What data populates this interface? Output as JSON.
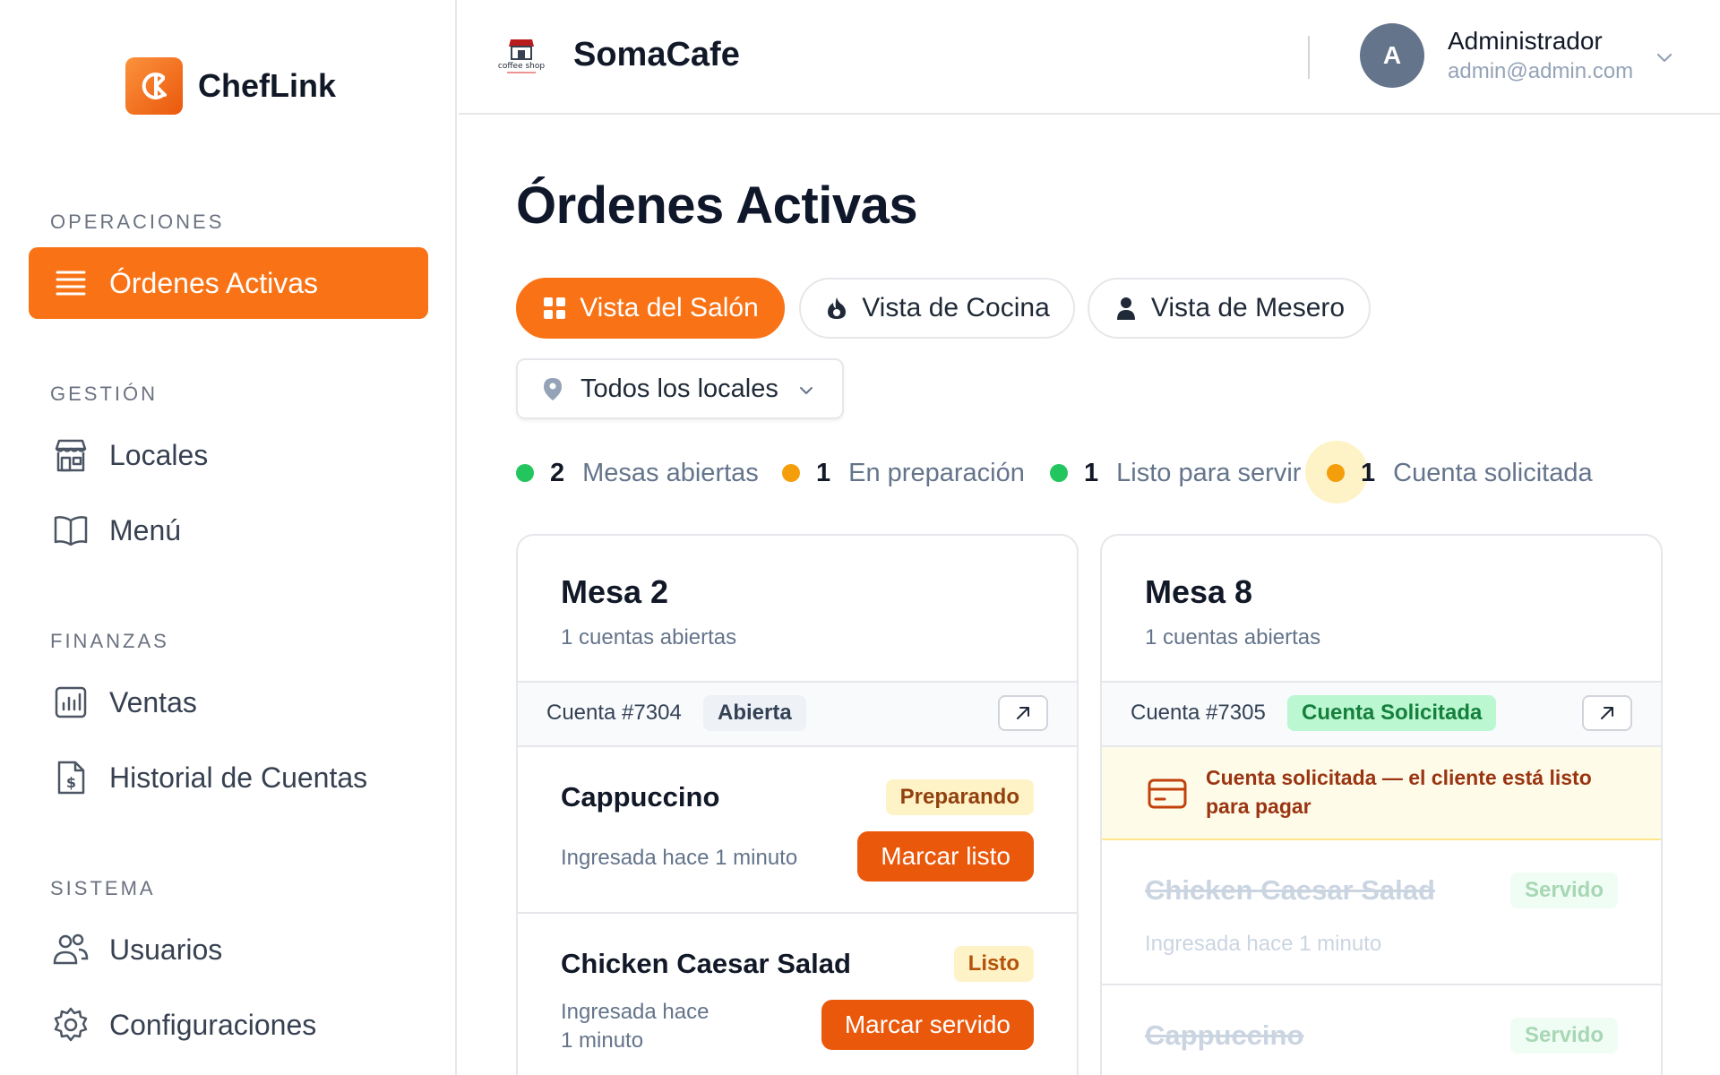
{
  "sidebar": {
    "brand": "ChefLink",
    "sections": {
      "operaciones": "OPERACIONES",
      "gestion": "GESTIÓN",
      "finanzas": "FINANZAS",
      "sistema": "SISTEMA"
    },
    "items": {
      "ordenes": "Órdenes Activas",
      "locales": "Locales",
      "menu": "Menú",
      "ventas": "Ventas",
      "historial": "Historial de Cuentas",
      "usuarios": "Usuarios",
      "configuraciones": "Configuraciones"
    },
    "active_item": "ordenes"
  },
  "header": {
    "shop_name": "SomaCafe",
    "logo_text": "coffee shop",
    "user": {
      "initial": "A",
      "name": "Administrador",
      "email": "admin@admin.com"
    }
  },
  "main": {
    "title": "Órdenes Activas",
    "tabs": {
      "salon": "Vista del Salón",
      "cocina": "Vista de Cocina",
      "mesero": "Vista de Mesero"
    },
    "active_tab": "salon",
    "locale_filter": "Todos los locales",
    "stats": [
      {
        "count": "2",
        "label": "Mesas abiertas",
        "color": "#22c55e"
      },
      {
        "count": "1",
        "label": "En preparación",
        "color": "#f59e0b"
      },
      {
        "count": "1",
        "label": "Listo para servir",
        "color": "#22c55e"
      },
      {
        "count": "1",
        "label": "Cuenta solicitada",
        "color": "#f59e0b"
      }
    ]
  },
  "cards": [
    {
      "title": "Mesa 2",
      "subtitle": "1 cuentas abiertas",
      "account": "Cuenta #7304",
      "account_status": "Abierta",
      "items": [
        {
          "name": "Cappuccino",
          "time": "Ingresada hace 1 minuto",
          "status": "Preparando",
          "action": "Marcar listo"
        },
        {
          "name": "Chicken Caesar Salad",
          "time_line1": "Ingresada hace",
          "time_line2": "1 minuto",
          "status": "Listo",
          "action": "Marcar servido"
        }
      ]
    },
    {
      "title": "Mesa 8",
      "subtitle": "1 cuentas abiertas",
      "account": "Cuenta #7305",
      "account_status": "Cuenta Solicitada",
      "banner": "Cuenta solicitada — el cliente está listo para pagar",
      "items": [
        {
          "name": "Chicken Caesar Salad",
          "time": "Ingresada hace 1 minuto",
          "status": "Servido"
        },
        {
          "name": "Cappuccino",
          "status": "Servido"
        }
      ]
    }
  ],
  "colors": {
    "accent": "#f97316",
    "accent_dark": "#ea580c",
    "success": "#22c55e",
    "warning": "#f59e0b"
  }
}
